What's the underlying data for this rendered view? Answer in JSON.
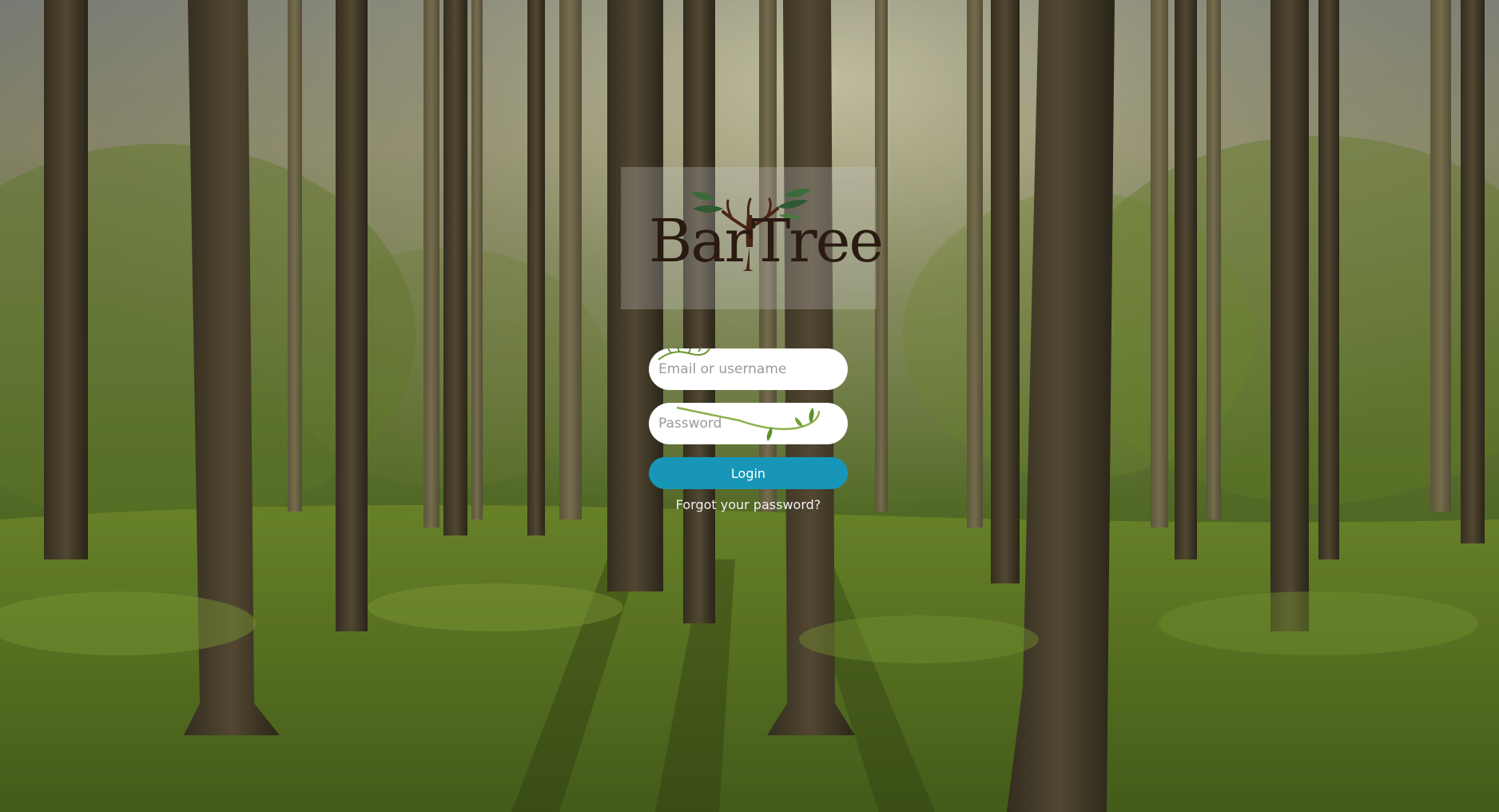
{
  "page": {
    "background": "forest-with-sunlight"
  },
  "logo": {
    "text": "BarTree",
    "icon": "tree-with-leaves-icon",
    "colors": {
      "trunk": "#4a2417",
      "leaf": "#2f5a32",
      "text": "#2a1a12"
    }
  },
  "form": {
    "email_placeholder": "Email or username",
    "password_placeholder": "Password",
    "login_label": "Login",
    "forgot_label": "Forgot your password?"
  },
  "colors": {
    "login_button": "#1896b8",
    "input_background": "#ffffff",
    "placeholder": "#9a9a9a",
    "vine": "#6f9a2e"
  }
}
